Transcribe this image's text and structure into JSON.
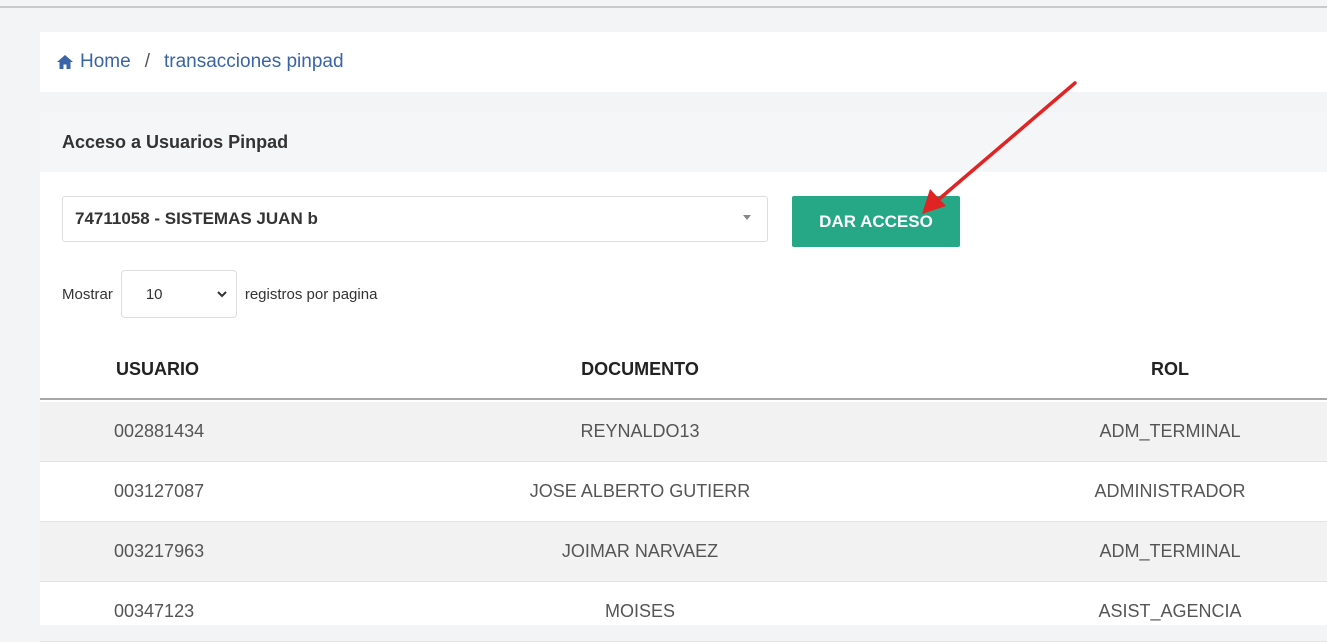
{
  "breadcrumb": {
    "home": "Home",
    "separator": "/",
    "current": "transacciones pinpad"
  },
  "card": {
    "title": "Acceso a Usuarios Pinpad",
    "select_value": "74711058 - SISTEMAS JUAN b",
    "button_label": "DAR ACCESO"
  },
  "length": {
    "prefix": "Mostrar",
    "value": "10",
    "suffix": "registros por pagina"
  },
  "table": {
    "columns": [
      "USUARIO",
      "DOCUMENTO",
      "ROL"
    ],
    "rows": [
      [
        "002881434",
        "REYNALDO13",
        "ADM_TERMINAL"
      ],
      [
        "003127087",
        "JOSE ALBERTO GUTIERR",
        "ADMINISTRADOR"
      ],
      [
        "003217963",
        "JOIMAR NARVAEZ",
        "ADM_TERMINAL"
      ],
      [
        "00347123",
        "MOISES",
        "ASIST_AGENCIA"
      ]
    ]
  },
  "colors": {
    "accent_button": "#26a785",
    "link": "#3a64a8",
    "annotation_arrow": "#e02424"
  },
  "icons": {
    "home": "home-icon",
    "select_caret": "caret-down-icon",
    "length_chevron": "chevron-down-icon"
  }
}
